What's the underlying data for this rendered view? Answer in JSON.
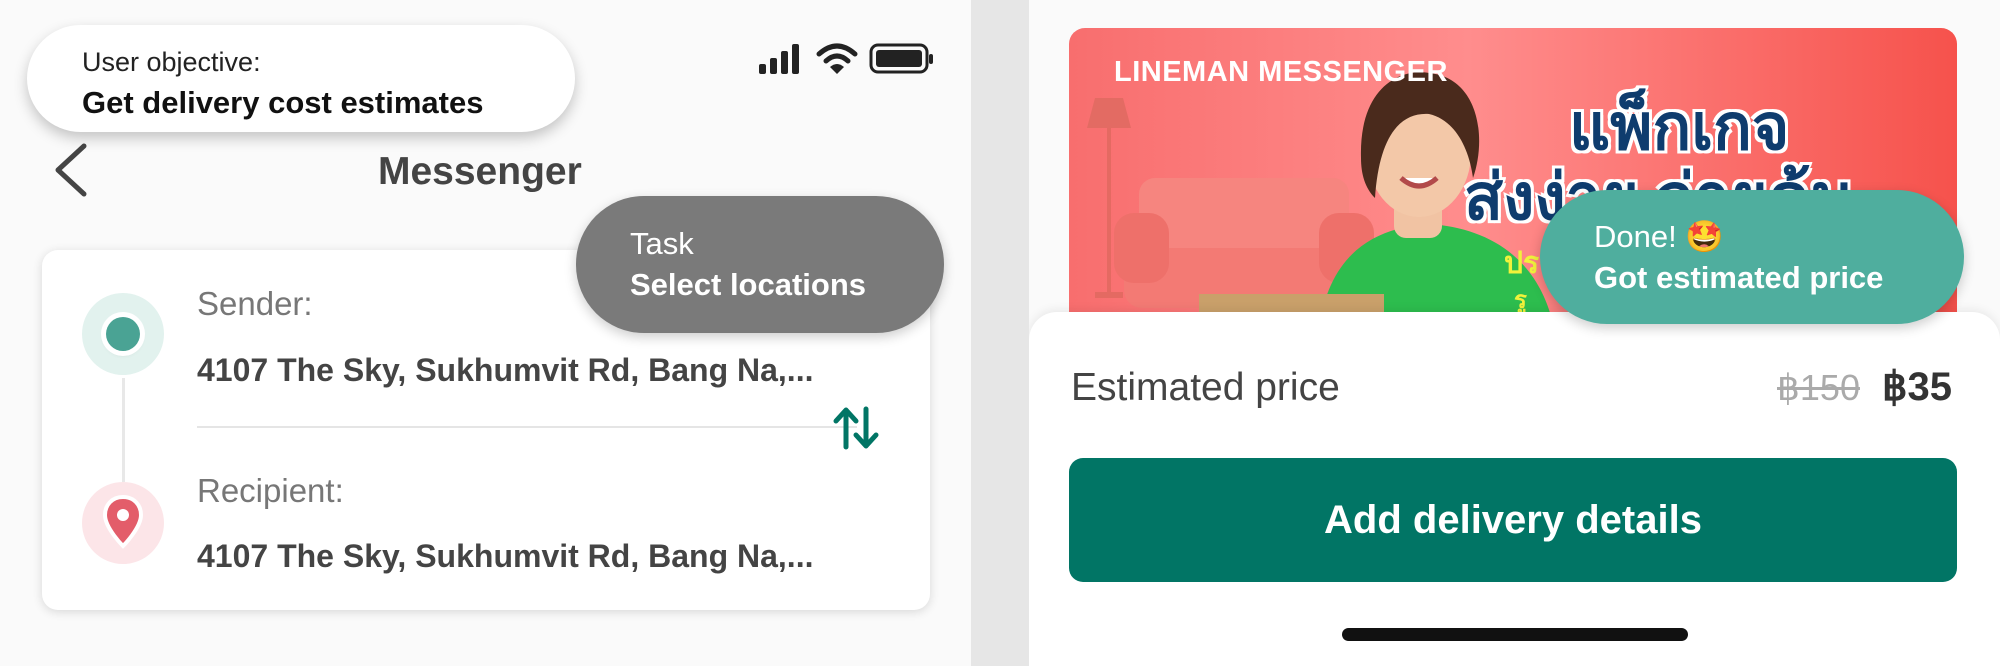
{
  "overlay": {
    "objective_label": "User objective:",
    "objective_text": "Get delivery cost estimates",
    "task_label": "Task",
    "task_text": "Select locations",
    "done_label": "Done! 🤩",
    "done_text": "Got estimated price"
  },
  "left_screen": {
    "status_icons": [
      "cellular-signal-icon",
      "wifi-icon",
      "battery-icon"
    ],
    "header": {
      "back_icon": "chevron-left-icon",
      "title": "Messenger"
    },
    "sender": {
      "label": "Sender:",
      "address": "4107 The Sky, Sukhumvit Rd, Bang Na,..."
    },
    "recipient": {
      "label": "Recipient:",
      "address": "4107 The Sky, Sukhumvit Rd, Bang Na,..."
    },
    "swap_icon": "swap-vertical-icon"
  },
  "right_screen": {
    "banner": {
      "brand": "LINEMAN MESSENGER",
      "headline_line1": "แพ็กเกจ",
      "headline_line2": "ส่งง่าย จ่ายคุ้ม"
    },
    "estimate": {
      "label": "Estimated price",
      "original_price": "฿150",
      "price": "฿35"
    },
    "cta_label": "Add delivery details"
  },
  "colors": {
    "primary_green": "#017565",
    "done_green": "#4fae9e",
    "task_gray": "#7a7a7a",
    "sender_dot": "#4aa394",
    "recipient_pin": "#e35d6a"
  }
}
